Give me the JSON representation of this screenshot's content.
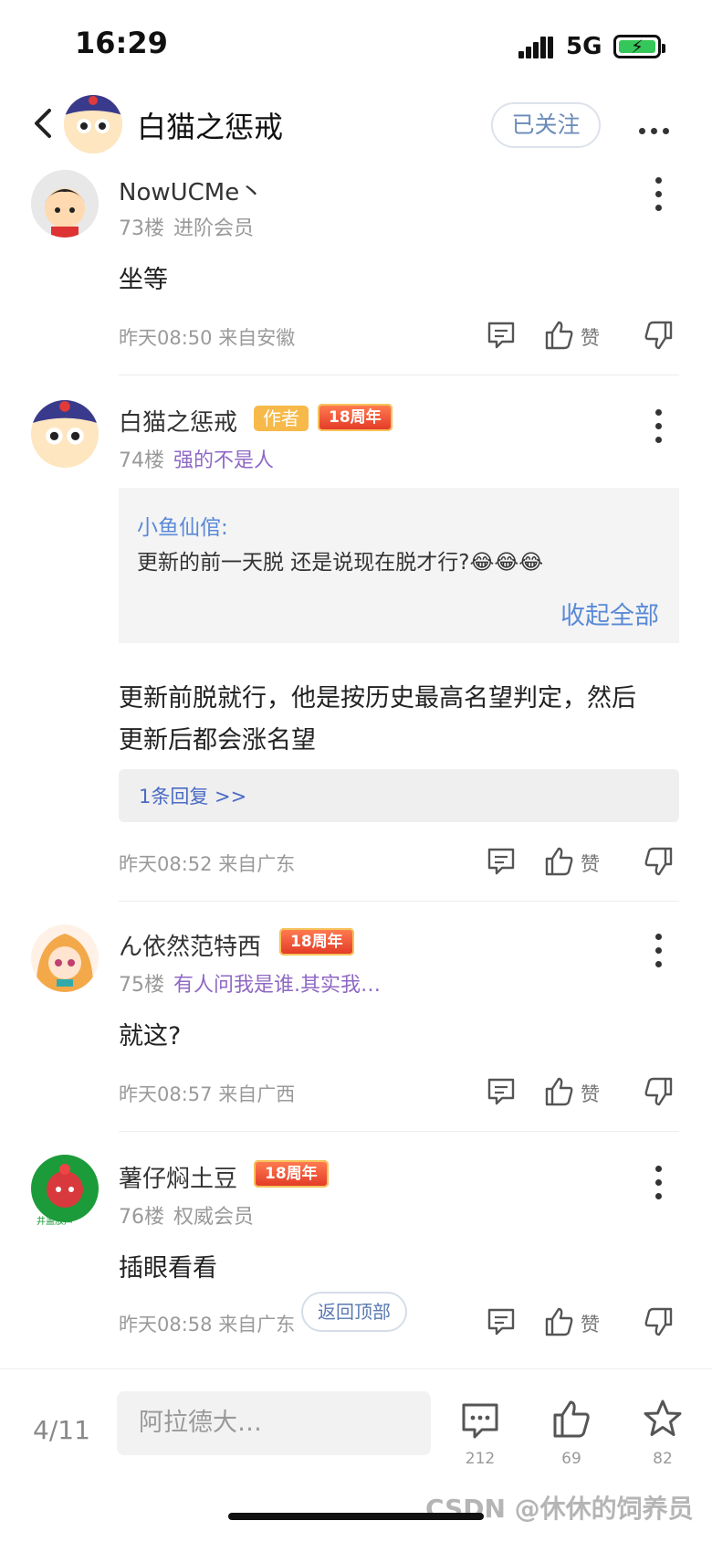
{
  "status_bar": {
    "time": "16:29",
    "network": "5G"
  },
  "header": {
    "title": "白猫之惩戒",
    "follow_label": "已关注"
  },
  "posts": [
    {
      "user": "NowUCMe丶",
      "floor": "73楼",
      "level": "进阶会员",
      "badges": [],
      "content": "坐等",
      "time": "昨天08:50 来自安徽",
      "like_label": "赞"
    },
    {
      "user": "白猫之惩戒",
      "floor": "74楼",
      "level": "强的不是人",
      "badges": [
        "作者",
        "18周年"
      ],
      "quote": {
        "user": "小鱼仙倌:",
        "text": "更新的前一天脱 还是说现在脱才行?😂😂😂",
        "collapse_label": "收起全部"
      },
      "content_line1": "更新前脱就行，他是按历史最高名望判定，然后",
      "content_line2": "更新后都会涨名望",
      "reply_link": "1条回复 >>",
      "time": "昨天08:52 来自广东",
      "like_label": "赞"
    },
    {
      "user": "ん依然范特西",
      "floor": "75楼",
      "level": "有人问我是谁.其实我…",
      "badges": [
        "18周年"
      ],
      "content": "就这?",
      "time": "昨天08:57 来自广西",
      "like_label": "赞"
    },
    {
      "user": "薯仔焖土豆",
      "floor": "76楼",
      "level": "权威会员",
      "badges": [
        "18周年"
      ],
      "avatar_caption": "井盖放声",
      "content": "插眼看看",
      "time": "昨天08:58 来自广东",
      "like_label": "赞"
    }
  ],
  "back_to_top": "返回顶部",
  "bottom_bar": {
    "page": "4/11",
    "input_placeholder": "阿拉德大…",
    "comment_count": "212",
    "like_count": "69",
    "star_count": "82"
  },
  "watermark": "CSDN @休休的饲养员",
  "icons": [
    "back-icon",
    "more-icon",
    "comment-icon",
    "thumb-up-icon",
    "thumb-down-icon",
    "star-icon"
  ]
}
